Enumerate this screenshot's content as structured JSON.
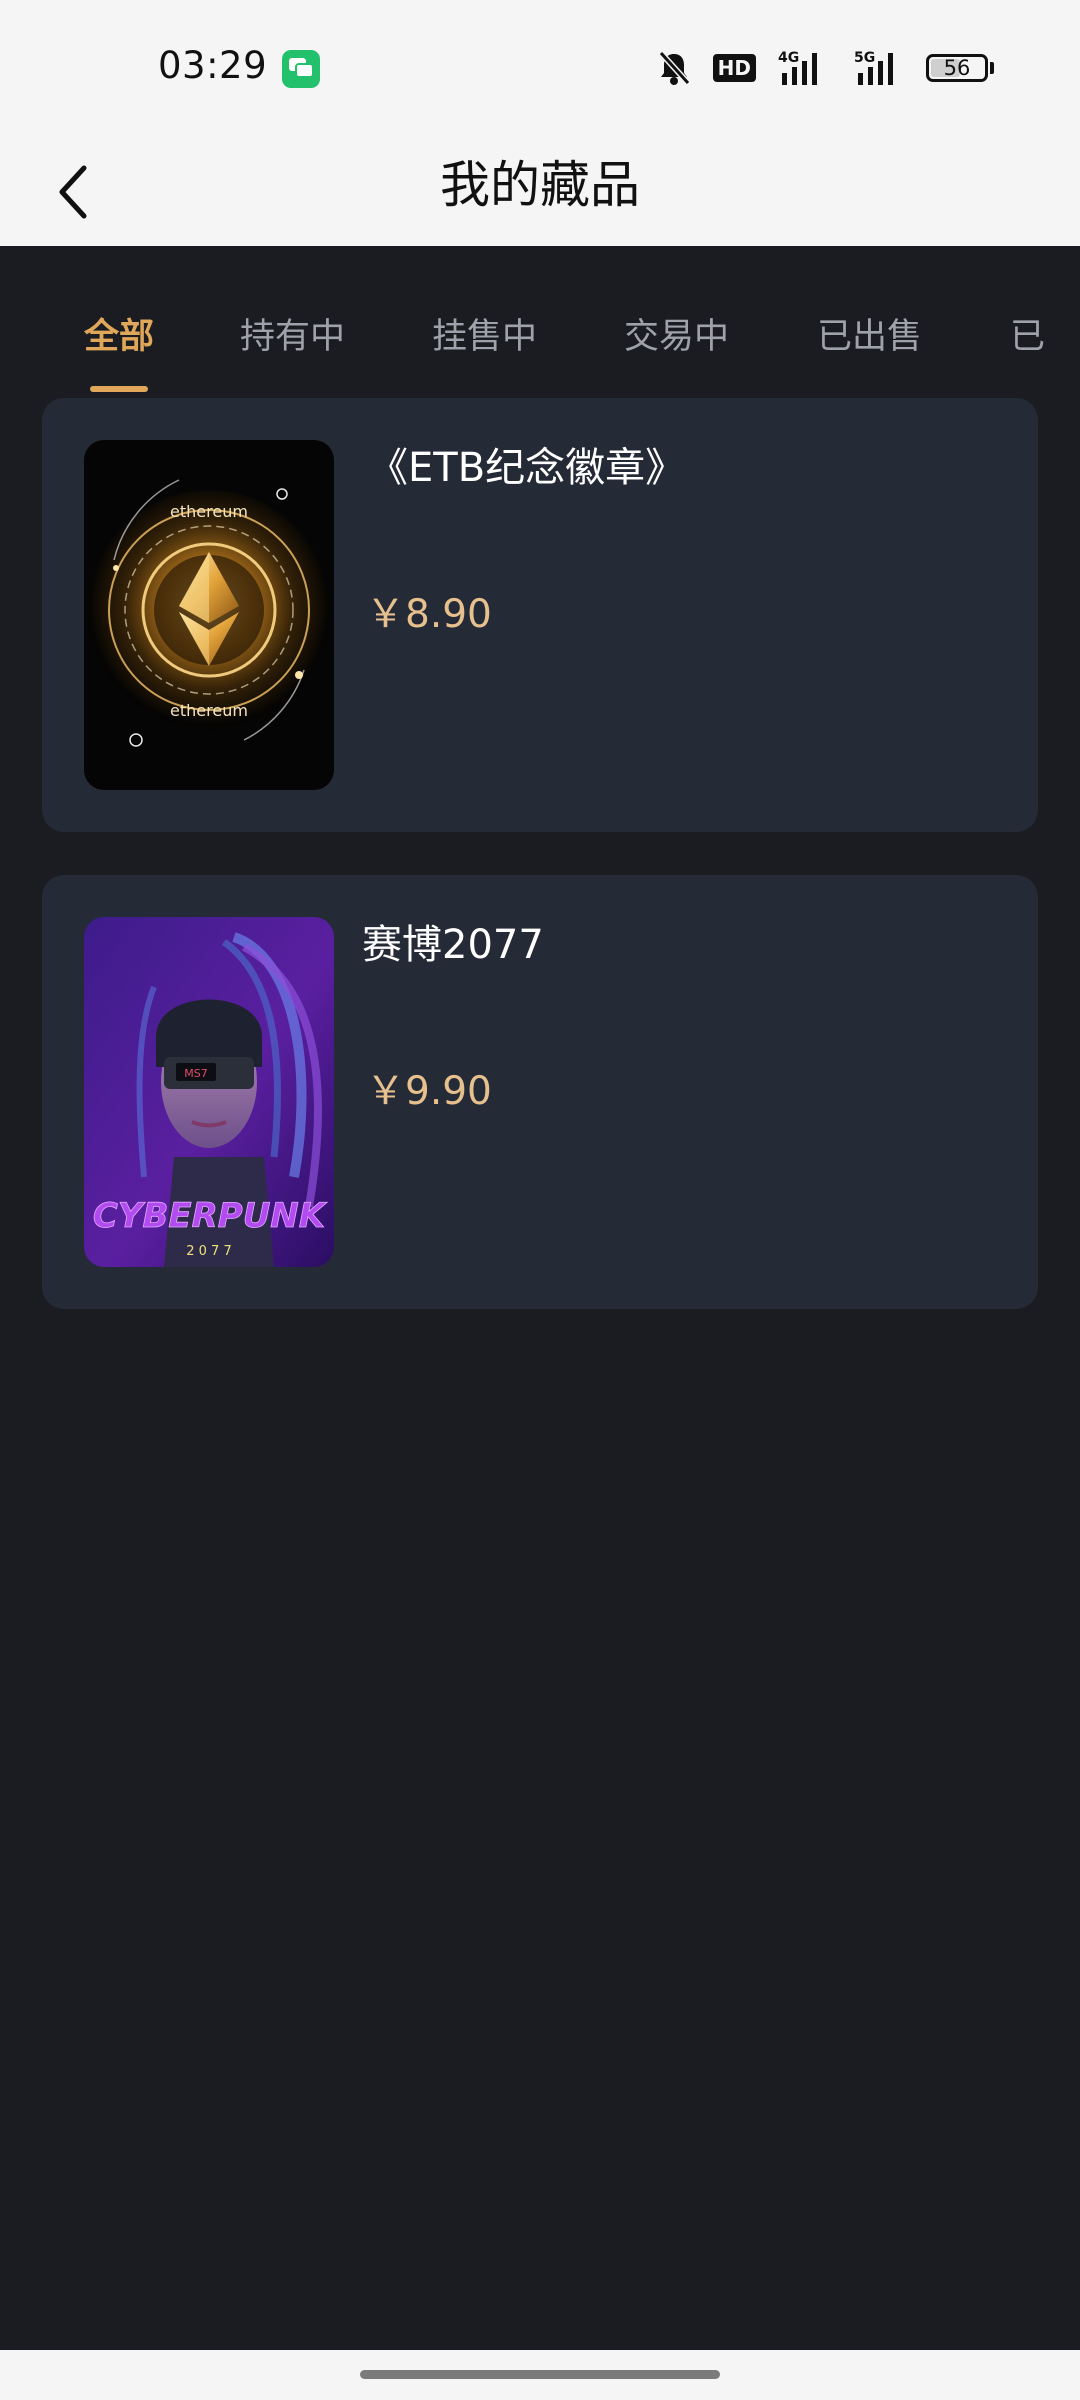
{
  "status_bar": {
    "time": "03:29",
    "hd": "HD",
    "network_1": "4G",
    "network_2": "5G",
    "battery": "56",
    "battery_level": 0.56,
    "icons": [
      "chat-app-icon",
      "bell-muted-icon",
      "hd-icon",
      "signal-4g-icon",
      "signal-5g-icon",
      "battery-icon"
    ]
  },
  "header": {
    "title": "我的藏品",
    "back_icon": "chevron-left-icon"
  },
  "tabs": [
    {
      "label": "全部",
      "active": true
    },
    {
      "label": "持有中",
      "active": false
    },
    {
      "label": "挂售中",
      "active": false
    },
    {
      "label": "交易中",
      "active": false
    },
    {
      "label": "已出售",
      "active": false
    },
    {
      "label": "已",
      "active": false
    }
  ],
  "colors": {
    "accent": "#e0a75a",
    "price": "#e6c08d",
    "background": "#1a1c21",
    "card": "#252a37"
  },
  "items": [
    {
      "name": "《ETB纪念徽章》",
      "price": "￥8.90",
      "image": "ethereum-badge-image",
      "image_texts": [
        "ethereum",
        "ethereum"
      ]
    },
    {
      "name": "赛博2077",
      "price": "￥9.90",
      "image": "cyberpunk-girl-image",
      "image_texts": [
        "CYBERPUNK",
        "2 0 7 7",
        "MS7"
      ]
    }
  ]
}
